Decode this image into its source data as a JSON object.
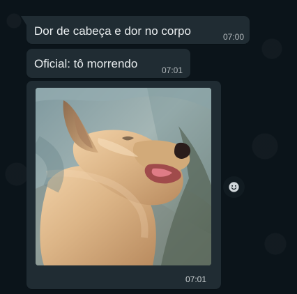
{
  "chat": {
    "messages": [
      {
        "text": "Dor de cabeça e dor no corpo",
        "time": "07:00"
      },
      {
        "text": "Oficial: tô morrendo",
        "time": "07:01"
      },
      {
        "type": "image",
        "time": "07:01",
        "image_description": "photo of a small tan dog yawning"
      }
    ],
    "reaction_icon": "smile-icon",
    "colors": {
      "background": "#0b141a",
      "bubble": "#202c33",
      "text": "#e9edef",
      "time": "#aab4ba"
    }
  }
}
